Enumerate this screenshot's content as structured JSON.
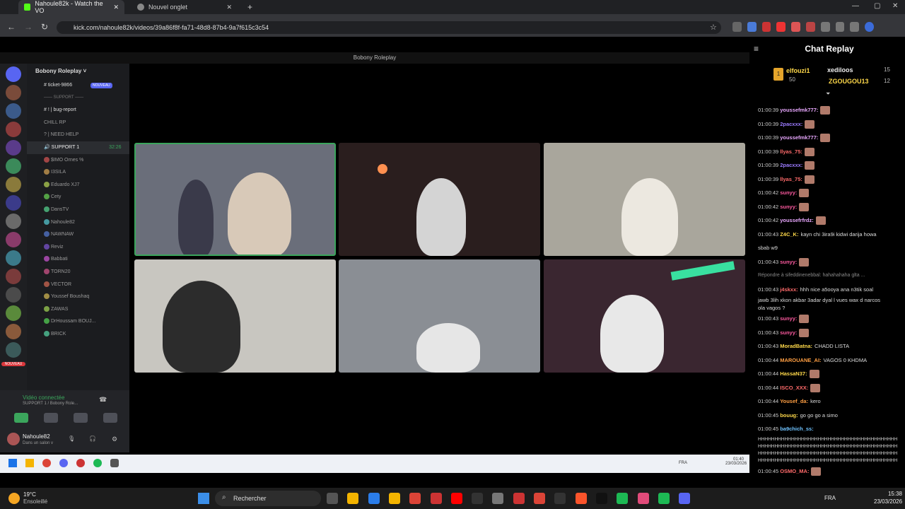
{
  "browser": {
    "tabs": [
      {
        "label": "Nahoule82k - Watch the VO"
      },
      {
        "label": "Nouvel onglet"
      }
    ],
    "url": "kick.com/nahoule82k/videos/39a86f8f-fa71-48d8-87b4-9a7f615c3c54"
  },
  "discord": {
    "window_title": "Bobony Roleplay",
    "server_name": "Bobony Roleplay",
    "channels": [
      {
        "name": "ticket-9866",
        "badge": "NOUVEAU"
      },
      {
        "name": "SUPPORT"
      },
      {
        "name": "bug-report"
      },
      {
        "name": "CHILL RP"
      },
      {
        "name": "NEED HELP"
      },
      {
        "name": "SUPPORT 1",
        "time": "32:26"
      }
    ],
    "members": [
      "$IMO Ornes %",
      "I3SILA",
      "Eduardo XJ7",
      "Cety",
      "DansTV",
      "Nahoule82",
      "NAWNAW",
      "Reviz",
      "Babbati",
      "TORN20",
      "VECTOR",
      "Youssef Boushaq",
      "ZAWAS",
      "DrHoussam BOUJ...",
      "BRICK"
    ],
    "voice_status": "Vidéo connectée",
    "voice_sub": "SUPPORT 1 / Bobony Role...",
    "user": "Nahoule82",
    "user_sub": "Dans un salon v",
    "new_label": "NOUVEAU"
  },
  "chat": {
    "title": "Chat Replay",
    "leaderboard": [
      {
        "rank": "1",
        "name": "elfouzi1",
        "count": "50"
      },
      {
        "name": "xediloos",
        "count": "15"
      },
      {
        "name": "ZGOUGOU13",
        "count": "12"
      }
    ],
    "messages": [
      {
        "time": "01:00:39",
        "user": "youssefmk777:",
        "text": "",
        "emote": true,
        "color": "#e9a8ff"
      },
      {
        "time": "01:00:39",
        "user": "2pacxxx:",
        "text": "",
        "emote": true,
        "color": "#9c7bff"
      },
      {
        "time": "01:00:39",
        "user": "youssefmk777:",
        "text": "",
        "emote": true,
        "color": "#e9a8ff"
      },
      {
        "time": "01:00:39",
        "user": "llyas_75:",
        "text": "",
        "emote": true,
        "color": "#ff6b6b"
      },
      {
        "time": "01:00:39",
        "user": "2pacxxx:",
        "text": "",
        "emote": true,
        "color": "#9c7bff"
      },
      {
        "time": "01:00:39",
        "user": "llyas_75:",
        "text": "",
        "emote": true,
        "color": "#ff6b6b"
      },
      {
        "time": "01:00:42",
        "user": "sunyy:",
        "text": "",
        "emote": true,
        "color": "#ff5aa0"
      },
      {
        "time": "01:00:42",
        "user": "sunyy:",
        "text": "",
        "emote": true,
        "color": "#ff5aa0"
      },
      {
        "time": "01:00:42",
        "user": "youssefrfrdz:",
        "text": "",
        "emote": true,
        "color": "#e9a8ff"
      },
      {
        "time": "01:00:43",
        "user": "Z4C_K:",
        "text": "kayn chi 3ira9i kidwi darija howa",
        "emote": false,
        "color": "#ffd94a"
      },
      {
        "time": "01:00:43",
        "user": "sunyy:",
        "text": "",
        "emote": true,
        "color": "#ff5aa0"
      },
      {
        "time": "01:00:43",
        "user": "j4skxx:",
        "text": "hhh nice a5ooya ana n3tik soal",
        "emote": false,
        "color": "#ff6b6b"
      },
      {
        "time": "01:00:43",
        "user": "sunyy:",
        "text": "",
        "emote": true,
        "color": "#ff5aa0"
      },
      {
        "time": "01:00:43",
        "user": "sunyy:",
        "text": "",
        "emote": true,
        "color": "#ff5aa0"
      },
      {
        "time": "01:00:43",
        "user": "MoradBatna:",
        "text": "CHADD LISTA",
        "emote": false,
        "color": "#ffd94a"
      },
      {
        "time": "01:00:44",
        "user": "MAROUANE_AI:",
        "text": "VAGOS 0 KHDMA",
        "emote": false,
        "color": "#ff9f43"
      },
      {
        "time": "01:00:44",
        "user": "HassaN37:",
        "text": "",
        "emote": true,
        "color": "#ffd94a"
      },
      {
        "time": "01:00:44",
        "user": "ISCO_XXX:",
        "text": "",
        "emote": true,
        "color": "#ff6b6b"
      },
      {
        "time": "01:00:44",
        "user": "Yousef_da:",
        "text": "kero",
        "emote": false,
        "color": "#ff9f43"
      },
      {
        "time": "01:00:45",
        "user": "bouug:",
        "text": "go go go a simo",
        "emote": false,
        "color": "#ffd94a"
      },
      {
        "time": "01:00:45",
        "user": "ba9chich_ss:",
        "text": "",
        "emote": false,
        "color": "#6fc3ff"
      },
      {
        "time": "01:00:45",
        "user": "OSMO_MA:",
        "text": "",
        "emote": true,
        "color": "#ff6b6b"
      }
    ],
    "reply_hint": "Répondre à sifeddinenebbal: hahahahaha glta ...",
    "wrap1": "sbab w9",
    "wrap2": "jawb 3lih xkon akbar 3adar dyal l vues wax d narcos",
    "wrap3": "ola vagos ?",
    "laugh": "HHHHHHHHHHHHHHHHHHHHHHHHHHHHHHHHHHHHHHHHHH"
  },
  "os": {
    "weather_temp": "19°C",
    "weather_desc": "Ensoleillé",
    "search": "Rechercher",
    "lang": "FRA",
    "time": "15:38",
    "date": "23/03/2026",
    "inner_time": "01:40",
    "inner_date": "23/03/2026"
  }
}
